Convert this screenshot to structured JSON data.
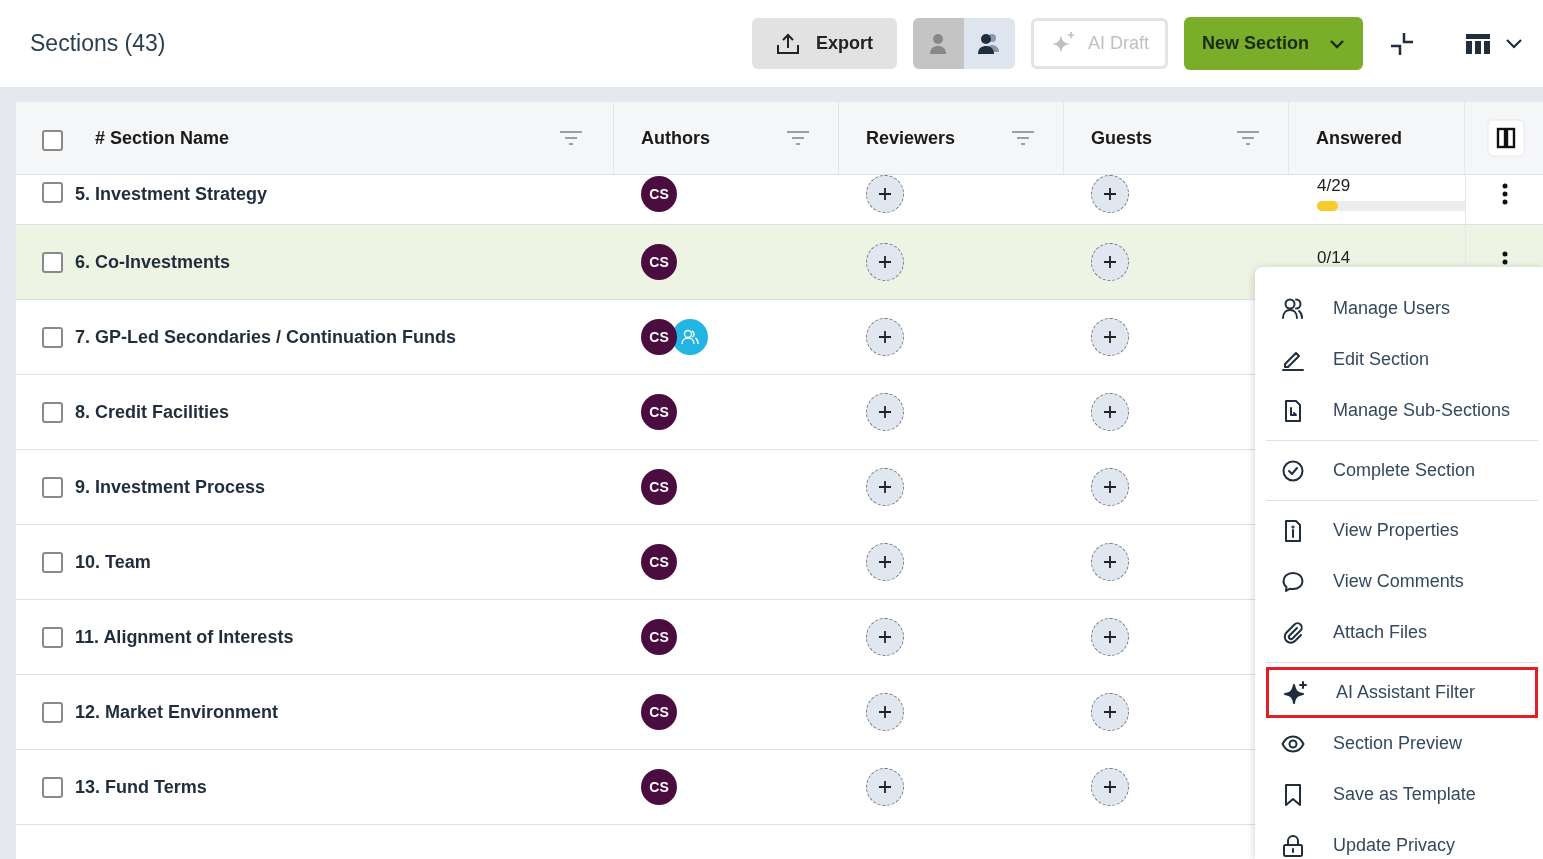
{
  "header": {
    "title": "Sections (43)",
    "export": "Export",
    "view_toggle": [
      {
        "kind": "single",
        "selected": true
      },
      {
        "kind": "multi",
        "selected": false
      }
    ],
    "ai_draft": {
      "label": "AI Draft",
      "disabled": true
    },
    "new_section": "New Section"
  },
  "table": {
    "select_all": {
      "checked": false
    },
    "columns": [
      {
        "label": "# Section Name",
        "filter": true
      },
      {
        "label": "Authors",
        "filter": true
      },
      {
        "label": "Reviewers",
        "filter": true
      },
      {
        "label": "Guests",
        "filter": true
      },
      {
        "label": "Answered",
        "filter": false
      }
    ],
    "rows": [
      {
        "number": "5.",
        "name": "Investment Strategy",
        "checked": false,
        "selected": false,
        "authors": [
          {
            "kind": "initials",
            "text": "CS"
          }
        ],
        "answered": {
          "text": "4/29",
          "level": 0.14
        }
      },
      {
        "number": "6.",
        "name": "Co-Investments",
        "checked": false,
        "selected": true,
        "authors": [
          {
            "kind": "initials",
            "text": "CS"
          }
        ],
        "answered": {
          "text": "0/14"
        }
      },
      {
        "number": "7.",
        "name": "GP-Led Secondaries / Continuation Funds",
        "checked": false,
        "selected": false,
        "authors": [
          {
            "kind": "initials",
            "text": "CS"
          },
          {
            "kind": "group"
          }
        ]
      },
      {
        "number": "8.",
        "name": "Credit Facilities",
        "checked": false,
        "selected": false,
        "authors": [
          {
            "kind": "initials",
            "text": "CS"
          }
        ]
      },
      {
        "number": "9.",
        "name": "Investment Process",
        "checked": false,
        "selected": false,
        "authors": [
          {
            "kind": "initials",
            "text": "CS"
          }
        ]
      },
      {
        "number": "10.",
        "name": "Team",
        "checked": false,
        "selected": false,
        "authors": [
          {
            "kind": "initials",
            "text": "CS"
          }
        ]
      },
      {
        "number": "11.",
        "name": "Alignment of Interests",
        "checked": false,
        "selected": false,
        "authors": [
          {
            "kind": "initials",
            "text": "CS"
          }
        ]
      },
      {
        "number": "12.",
        "name": "Market Environment",
        "checked": false,
        "selected": false,
        "authors": [
          {
            "kind": "initials",
            "text": "CS"
          }
        ]
      },
      {
        "number": "13.",
        "name": "Fund Terms",
        "checked": false,
        "selected": false,
        "authors": [
          {
            "kind": "initials",
            "text": "CS"
          }
        ]
      }
    ]
  },
  "context_menu": {
    "groups": [
      [
        {
          "label": "Manage Users",
          "highlighted": false
        },
        {
          "label": "Edit Section",
          "highlighted": false
        },
        {
          "label": "Manage Sub-Sections",
          "highlighted": false
        }
      ],
      [
        {
          "label": "Complete Section",
          "highlighted": false
        }
      ],
      [
        {
          "label": "View Properties",
          "highlighted": false
        },
        {
          "label": "View Comments",
          "highlighted": false
        },
        {
          "label": "Attach Files",
          "highlighted": false
        }
      ],
      [
        {
          "label": "AI Assistant Filter",
          "highlighted": true
        },
        {
          "label": "Section Preview",
          "highlighted": false
        },
        {
          "label": "Save as Template",
          "highlighted": false
        },
        {
          "label": "Update Privacy",
          "highlighted": false
        }
      ]
    ]
  }
}
